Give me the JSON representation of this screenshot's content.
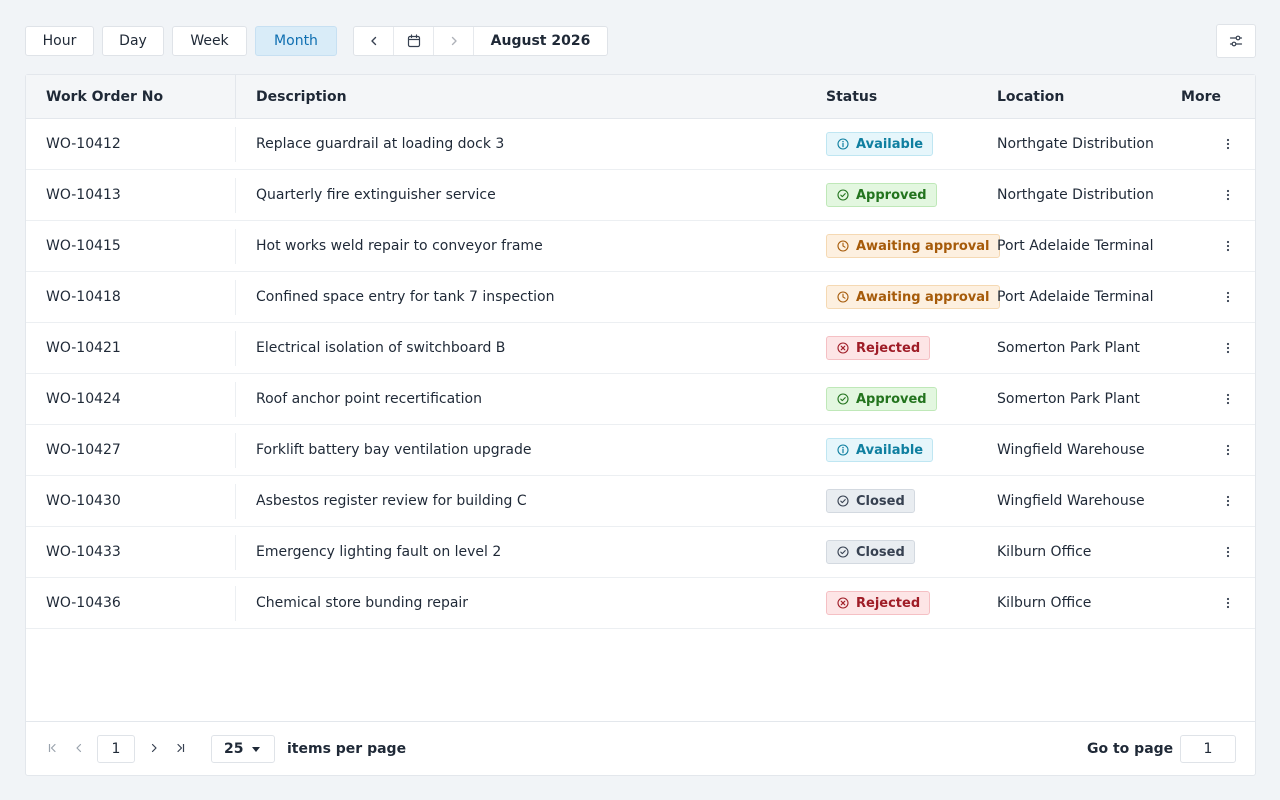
{
  "views": {
    "hour": "Hour",
    "day": "Day",
    "week": "Week",
    "month": "Month",
    "active": "Month"
  },
  "period": "August 2026",
  "table": {
    "columns": [
      "Work Order No",
      "Description",
      "Status",
      "Location",
      "More"
    ],
    "rows": [
      {
        "wo": "WO-10412",
        "description": "Replace guardrail at loading dock 3",
        "status": "Available",
        "location": "Northgate Distribution"
      },
      {
        "wo": "WO-10413",
        "description": "Quarterly fire extinguisher service",
        "status": "Approved",
        "location": "Northgate Distribution"
      },
      {
        "wo": "WO-10415",
        "description": "Hot works weld repair to conveyor frame",
        "status": "Awaiting approval",
        "location": "Port Adelaide Terminal"
      },
      {
        "wo": "WO-10418",
        "description": "Confined space entry for tank 7 inspection",
        "status": "Awaiting approval",
        "location": "Port Adelaide Terminal"
      },
      {
        "wo": "WO-10421",
        "description": "Electrical isolation of switchboard B",
        "status": "Rejected",
        "location": "Somerton Park Plant"
      },
      {
        "wo": "WO-10424",
        "description": "Roof anchor point recertification",
        "status": "Approved",
        "location": "Somerton Park Plant"
      },
      {
        "wo": "WO-10427",
        "description": "Forklift battery bay ventilation upgrade",
        "status": "Available",
        "location": "Wingfield Warehouse"
      },
      {
        "wo": "WO-10430",
        "description": "Asbestos register review for building C",
        "status": "Closed",
        "location": "Wingfield Warehouse"
      },
      {
        "wo": "WO-10433",
        "description": "Emergency lighting fault on level 2",
        "status": "Closed",
        "location": "Kilburn Office"
      },
      {
        "wo": "WO-10436",
        "description": "Chemical store bunding repair",
        "status": "Rejected",
        "location": "Kilburn Office"
      }
    ]
  },
  "status_colors": {
    "Available": "#0f7fa0",
    "Approved": "#23741e",
    "Awaiting approval": "#a65b0a",
    "Rejected": "#9f1d27",
    "Closed": "#374151"
  },
  "pagination": {
    "current_page": "1",
    "per_page": "25",
    "per_page_label": "items per page",
    "goto_label": "Go to page",
    "goto_value": "1"
  },
  "icons": {
    "prev": "chevron-left-icon",
    "calendar": "calendar-icon",
    "next": "chevron-right-icon",
    "filter": "sliders-icon",
    "more": "vertical-ellipsis-icon",
    "first": "first-page-icon",
    "last": "last-page-icon"
  }
}
